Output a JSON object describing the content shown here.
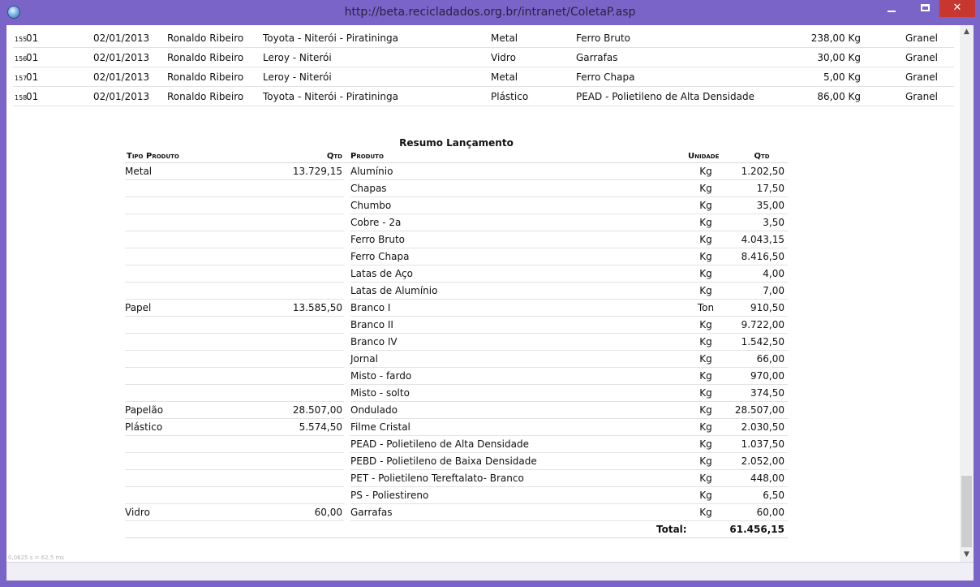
{
  "window": {
    "title": "http://beta.recicladados.org.br/intranet/ColetaP.asp",
    "minimize": "",
    "maximize": "",
    "close": "✕"
  },
  "list": {
    "rows": [
      {
        "num": "155",
        "op": "01",
        "date": "02/01/2013",
        "name": "Ronaldo Ribeiro",
        "place": "Toyota - Niterói - Piratininga",
        "type": "Metal",
        "product": "Ferro Bruto",
        "qty": "238,00 Kg",
        "form": "Granel"
      },
      {
        "num": "156",
        "op": "01",
        "date": "02/01/2013",
        "name": "Ronaldo Ribeiro",
        "place": "Leroy - Niterói",
        "type": "Vidro",
        "product": "Garrafas",
        "qty": "30,00 Kg",
        "form": "Granel"
      },
      {
        "num": "157",
        "op": "01",
        "date": "02/01/2013",
        "name": "Ronaldo Ribeiro",
        "place": "Leroy - Niterói",
        "type": "Metal",
        "product": "Ferro Chapa",
        "qty": "5,00 Kg",
        "form": "Granel"
      },
      {
        "num": "158",
        "op": "01",
        "date": "02/01/2013",
        "name": "Ronaldo Ribeiro",
        "place": "Toyota - Niterói - Piratininga",
        "type": "Plástico",
        "product": "PEAD - Polietileno de Alta Densidade",
        "qty": "86,00 Kg",
        "form": "Granel"
      }
    ]
  },
  "summary": {
    "title": "Resumo Lançamento",
    "headers": {
      "tipo": "Tipo Produto",
      "qtd1": "Qtd",
      "produto": "Produto",
      "unidade": "Unidade",
      "qtd2": "Qtd"
    },
    "rows": [
      {
        "tipo": "Metal",
        "qtd1": "13.729,15",
        "produto": "Alumínio",
        "unidade": "Kg",
        "qtd2": "1.202,50"
      },
      {
        "tipo": "",
        "qtd1": "",
        "produto": "Chapas",
        "unidade": "Kg",
        "qtd2": "17,50"
      },
      {
        "tipo": "",
        "qtd1": "",
        "produto": "Chumbo",
        "unidade": "Kg",
        "qtd2": "35,00"
      },
      {
        "tipo": "",
        "qtd1": "",
        "produto": "Cobre - 2a",
        "unidade": "Kg",
        "qtd2": "3,50"
      },
      {
        "tipo": "",
        "qtd1": "",
        "produto": "Ferro Bruto",
        "unidade": "Kg",
        "qtd2": "4.043,15"
      },
      {
        "tipo": "",
        "qtd1": "",
        "produto": "Ferro Chapa",
        "unidade": "Kg",
        "qtd2": "8.416,50"
      },
      {
        "tipo": "",
        "qtd1": "",
        "produto": "Latas de Aço",
        "unidade": "Kg",
        "qtd2": "4,00"
      },
      {
        "tipo": "",
        "qtd1": "",
        "produto": "Latas de Alumínio",
        "unidade": "Kg",
        "qtd2": "7,00"
      },
      {
        "tipo": "Papel",
        "qtd1": "13.585,50",
        "produto": "Branco I",
        "unidade": "Ton",
        "qtd2": "910,50"
      },
      {
        "tipo": "",
        "qtd1": "",
        "produto": "Branco II",
        "unidade": "Kg",
        "qtd2": "9.722,00"
      },
      {
        "tipo": "",
        "qtd1": "",
        "produto": "Branco IV",
        "unidade": "Kg",
        "qtd2": "1.542,50"
      },
      {
        "tipo": "",
        "qtd1": "",
        "produto": "Jornal",
        "unidade": "Kg",
        "qtd2": "66,00"
      },
      {
        "tipo": "",
        "qtd1": "",
        "produto": "Misto - fardo",
        "unidade": "Kg",
        "qtd2": "970,00"
      },
      {
        "tipo": "",
        "qtd1": "",
        "produto": "Misto - solto",
        "unidade": "Kg",
        "qtd2": "374,50"
      },
      {
        "tipo": "Papelão",
        "qtd1": "28.507,00",
        "produto": "Ondulado",
        "unidade": "Kg",
        "qtd2": "28.507,00"
      },
      {
        "tipo": "Plástico",
        "qtd1": "5.574,50",
        "produto": "Filme Cristal",
        "unidade": "Kg",
        "qtd2": "2.030,50"
      },
      {
        "tipo": "",
        "qtd1": "",
        "produto": "PEAD - Polietileno de Alta Densidade",
        "unidade": "Kg",
        "qtd2": "1.037,50"
      },
      {
        "tipo": "",
        "qtd1": "",
        "produto": "PEBD - Polietileno de Baixa Densidade",
        "unidade": "Kg",
        "qtd2": "2.052,00"
      },
      {
        "tipo": "",
        "qtd1": "",
        "produto": "PET - Polietileno Tereftalato- Branco",
        "unidade": "Kg",
        "qtd2": "448,00"
      },
      {
        "tipo": "",
        "qtd1": "",
        "produto": "PS - Poliestireno",
        "unidade": "Kg",
        "qtd2": "6,50"
      },
      {
        "tipo": "Vidro",
        "qtd1": "60,00",
        "produto": "Garrafas",
        "unidade": "Kg",
        "qtd2": "60,00"
      }
    ],
    "total_label": "Total:",
    "total_value": "61.456,15"
  },
  "timing": "0,0625 s = 62,5 ms",
  "colors": {
    "chrome": "#7b64c8",
    "close": "#c7372f"
  }
}
